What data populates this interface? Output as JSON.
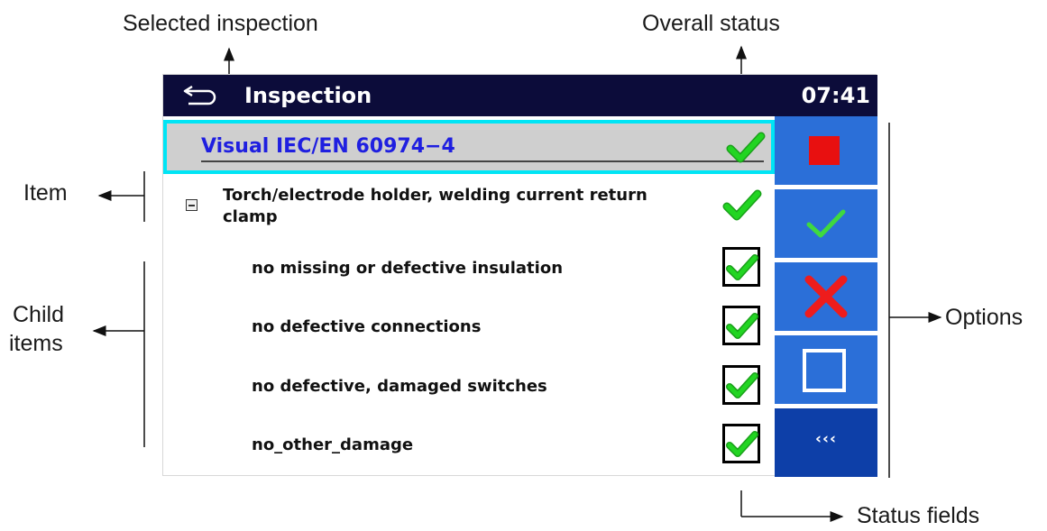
{
  "annotations": {
    "selected_inspection": "Selected inspection",
    "overall_status": "Overall status",
    "item": "Item",
    "child_items_line1": "Child",
    "child_items_line2": "items",
    "options": "Options",
    "status_fields": "Status fields"
  },
  "header": {
    "title": "Inspection",
    "time": "07:41"
  },
  "selected_inspection": {
    "label": "Visual IEC/EN 60974−4",
    "status": "pass"
  },
  "item": {
    "label": "Torch/electrode holder, welding current return clamp",
    "status": "pass"
  },
  "child_items": [
    {
      "label": "no missing or defective insulation",
      "status": "pass"
    },
    {
      "label": "no defective connections",
      "status": "pass"
    },
    {
      "label": "no defective, damaged switches",
      "status": "pass"
    },
    {
      "label": "no_other_damage",
      "status": "pass"
    }
  ],
  "options": {
    "more_label": "‹‹‹"
  },
  "colors": {
    "titlebar": "#0c0c3a",
    "selection_border": "#00e5f5",
    "selected_text": "#1f1fe0",
    "option_button": "#2b6fd8",
    "option_more": "#0d3fa8",
    "pass_check": "#22d522",
    "fail_x": "#ee1c1c",
    "stop_square": "#e81010"
  },
  "icons": [
    "back-icon",
    "check-icon",
    "collapse-icon",
    "stop-icon",
    "pass-icon",
    "fail-icon",
    "empty-square-icon",
    "more-icon"
  ]
}
